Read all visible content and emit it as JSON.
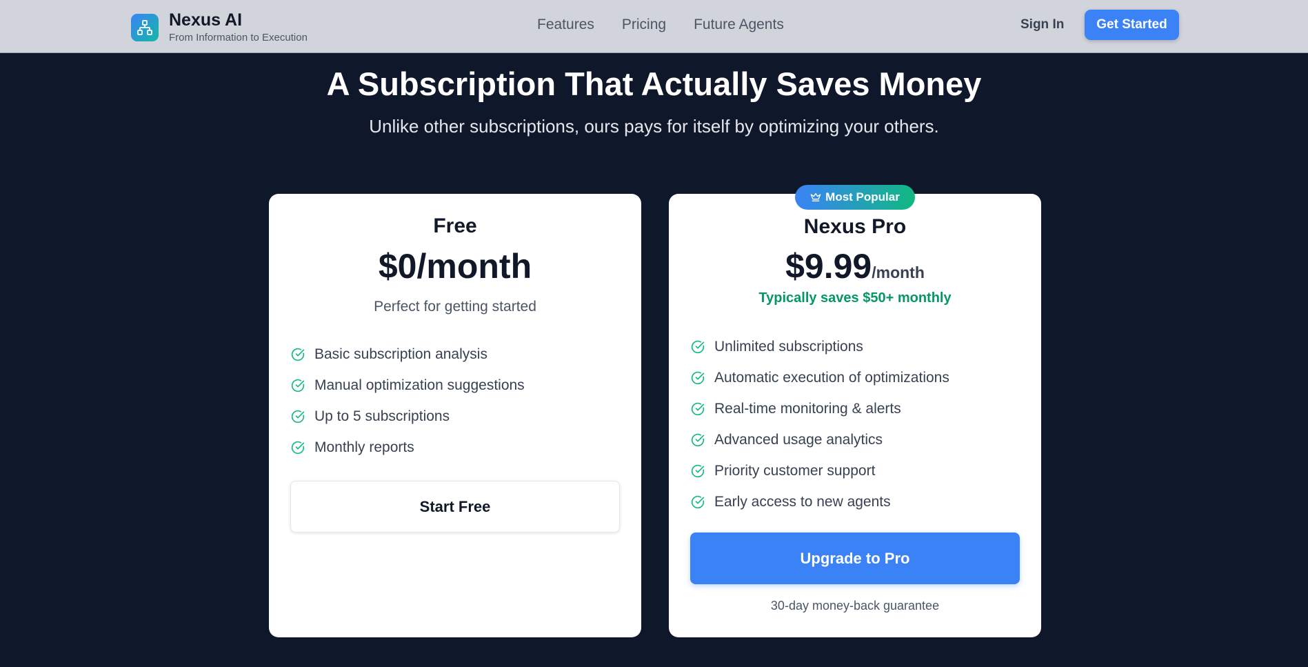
{
  "header": {
    "brand_name": "Nexus AI",
    "brand_tagline": "From Information to Execution",
    "nav": [
      "Features",
      "Pricing",
      "Future Agents"
    ],
    "sign_in": "Sign In",
    "get_started": "Get Started"
  },
  "hero": {
    "title": "A Subscription That Actually Saves Money",
    "subtitle": "Unlike other subscriptions, ours pays for itself by optimizing your others."
  },
  "plans": {
    "free": {
      "name": "Free",
      "price": "$0/month",
      "description": "Perfect for getting started",
      "features": [
        "Basic subscription analysis",
        "Manual optimization suggestions",
        "Up to 5 subscriptions",
        "Monthly reports"
      ],
      "cta": "Start Free"
    },
    "pro": {
      "badge": "Most Popular",
      "name": "Nexus Pro",
      "price_amount": "$9.99",
      "price_period": "/month",
      "savings": "Typically saves $50+ monthly",
      "features": [
        "Unlimited subscriptions",
        "Automatic execution of optimizations",
        "Real-time monitoring & alerts",
        "Advanced usage analytics",
        "Priority customer support",
        "Early access to new agents"
      ],
      "cta": "Upgrade to Pro",
      "guarantee": "30-day money-back guarantee"
    }
  },
  "colors": {
    "accent": "#3b82f6",
    "success": "#10b981",
    "background": "#0f172a"
  },
  "icons": {
    "logo": "network-icon",
    "feature": "check-circle-icon",
    "badge": "crown-icon"
  }
}
